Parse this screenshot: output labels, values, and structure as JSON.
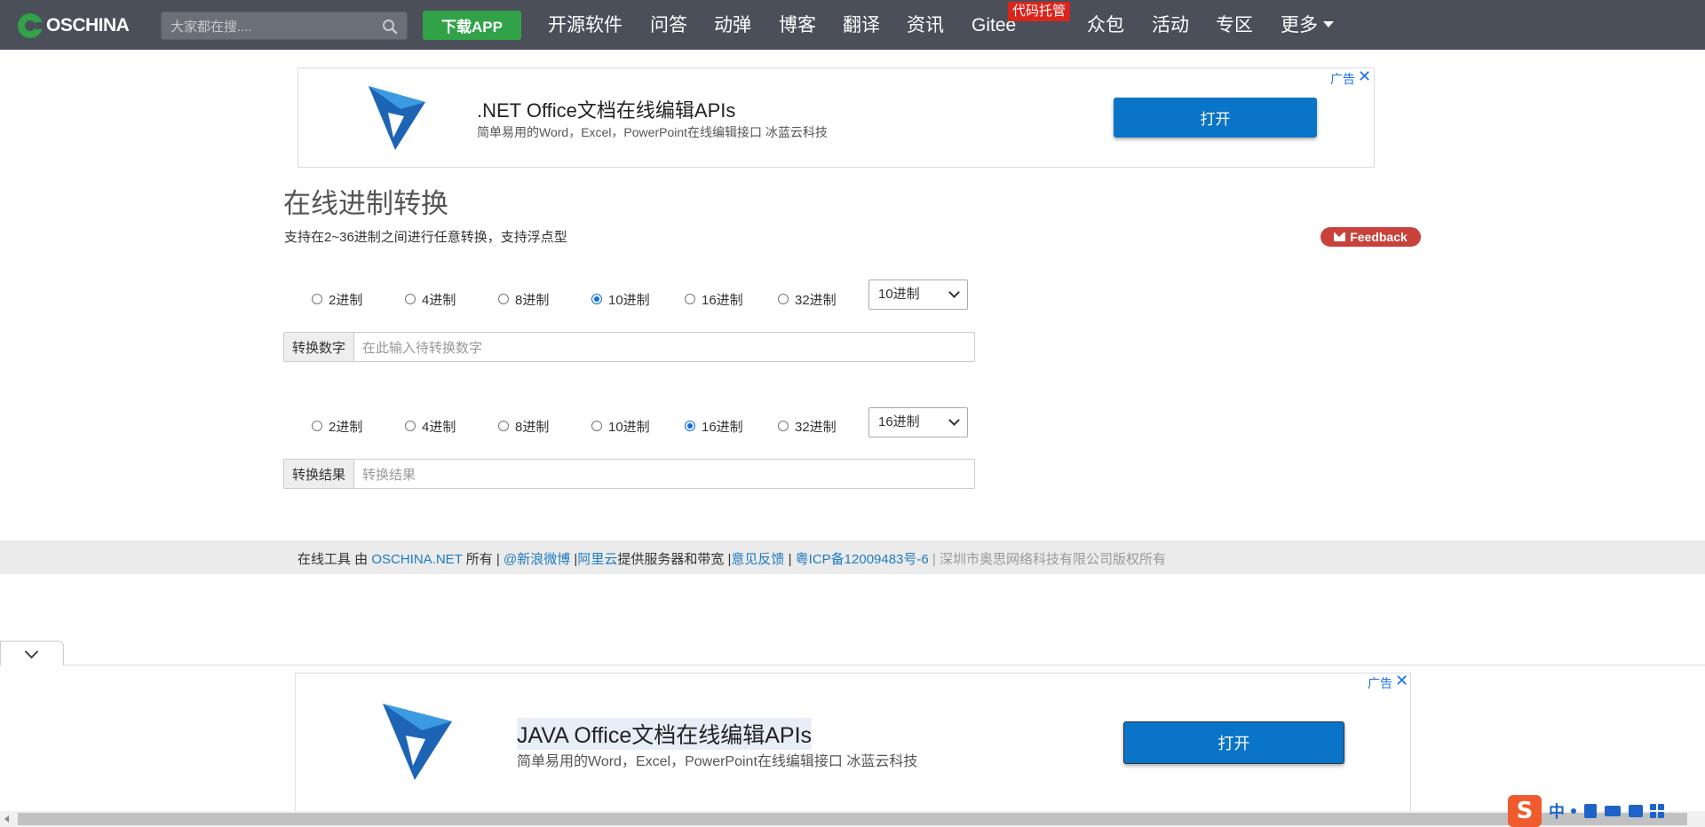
{
  "nav": {
    "logo_text": "OSCHINA",
    "search_placeholder": "大家都在搜....",
    "download_label": "下载APP",
    "items": [
      "开源软件",
      "问答",
      "动弹",
      "博客",
      "翻译",
      "资讯",
      "Gitee",
      "众包",
      "活动",
      "专区",
      "更多"
    ],
    "gitee_badge": "代码托管"
  },
  "ad_top": {
    "label": "广告",
    "close": "✕",
    "title": ".NET Office文档在线编辑APIs",
    "desc": "简单易用的Word，Excel，PowerPoint在线编辑接口 冰蓝云科技",
    "button": "打开"
  },
  "tool": {
    "title": "在线进制转换",
    "subtitle": "支持在2~36进制之间进行任意转换，支持浮点型",
    "feedback": "Feedback",
    "radix_options": [
      "2进制",
      "4进制",
      "8进制",
      "10进制",
      "16进制",
      "32进制"
    ],
    "from": {
      "selected_index": 3,
      "select_value": "10进制",
      "field_label": "转换数字",
      "placeholder": "在此输入待转换数字"
    },
    "to": {
      "selected_index": 4,
      "select_value": "16进制",
      "field_label": "转换结果",
      "placeholder": "转换结果"
    }
  },
  "footer": {
    "p1": "在线工具 由 ",
    "l1": "OSCHINA.NET",
    "p2": " 所有 | ",
    "l2": "@新浪微博",
    "p3": " |",
    "l3": "阿里云",
    "p4": "提供服务器和带宽 |",
    "l4": "意见反馈",
    "p5": " | ",
    "l5": "粤ICP备12009483号-6",
    "p6": " | ",
    "m1": "深圳市奥思网络科技有限公司版权所有"
  },
  "ad_bottom": {
    "label": "广告",
    "close": "✕",
    "title": "JAVA Office文档在线编辑APIs",
    "desc": "简单易用的Word，Excel，PowerPoint在线编辑接口 冰蓝云科技",
    "button": "打开"
  },
  "ime": {
    "logo": "S",
    "mode": "中"
  },
  "colors": {
    "nav_bg": "#4a4f59",
    "brand_green": "#31a248",
    "ad_button": "#0a74c9",
    "feedback": "#c9413b",
    "link": "#1e7ac2"
  }
}
